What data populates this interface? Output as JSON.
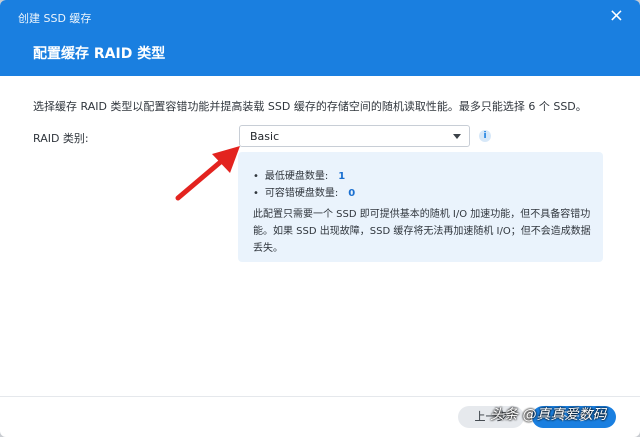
{
  "window": {
    "title": "创建 SSD 缓存",
    "close_symbol": "×"
  },
  "step": {
    "title": "配置缓存 RAID 类型"
  },
  "description": "选择缓存 RAID 类型以配置容错功能并提高装载 SSD 缓存的存储空间的随机读取性能。最多只能选择 6 个 SSD。",
  "raid_field": {
    "label": "RAID 类别:",
    "value": "Basic",
    "info_symbol": "i"
  },
  "info_panel": {
    "min_disks_label": "最低硬盘数量:",
    "min_disks_value": "1",
    "fault_tolerance_label": "可容错硬盘数量:",
    "fault_tolerance_value": "0",
    "note": "此配置只需要一个 SSD 即可提供基本的随机 I/O 加速功能，但不具备容错功能。如果 SSD 出现故障，SSD 缓存将无法再加速随机 I/O；但不会造成数据丢失。"
  },
  "footer": {
    "prev_label": "上一步",
    "next_label": "下一步"
  },
  "watermark": "头条 @真真爱数码",
  "colors": {
    "header": "#1a7fe0",
    "panel": "#eaf3fc",
    "accent_number": "#1a6fd0",
    "arrow": "#e3231f"
  }
}
